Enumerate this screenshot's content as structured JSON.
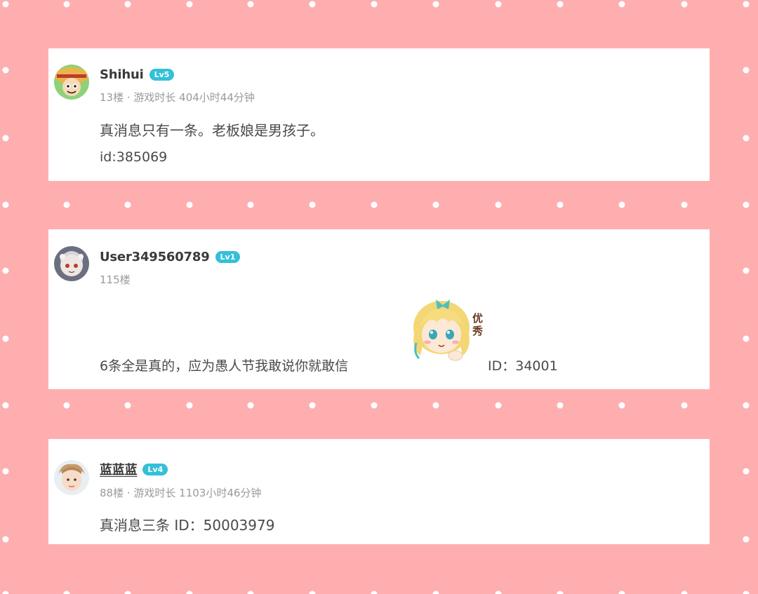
{
  "posts": [
    {
      "username": "Shihui",
      "level": "Lv5",
      "meta": "13楼 · 游戏时长 404小时44分钟",
      "content": "真消息只有一条。老板娘是男孩子。",
      "extra": "id:385069"
    },
    {
      "username": "User349560789",
      "level": "Lv1",
      "meta": "115楼",
      "content": "6条全是真的，应为愚人节我敢说你就敢信",
      "sticker_text": "优秀",
      "extra": "ID：34001"
    },
    {
      "username": "蓝蓝蓝",
      "level": "Lv4",
      "meta": "88楼 · 游戏时长 1103小时46分钟",
      "content": "真消息三条 ID：50003979"
    }
  ],
  "colors": {
    "background": "#ffaeb0",
    "card": "#ffffff",
    "badge": "#34c0d8"
  }
}
